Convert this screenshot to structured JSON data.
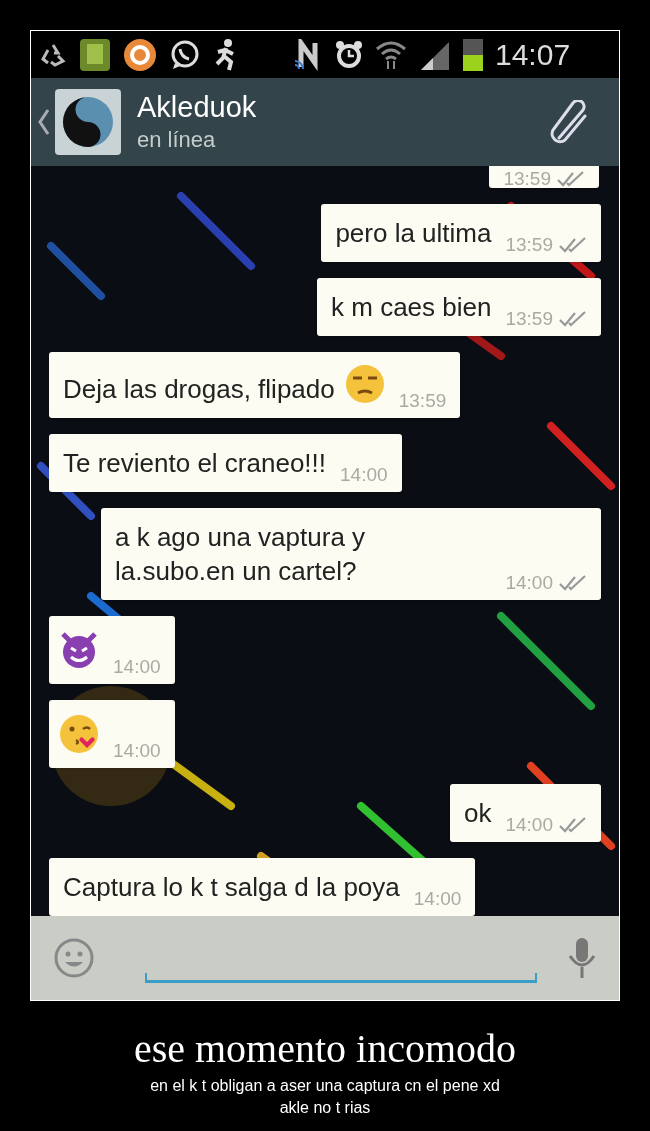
{
  "status_bar": {
    "time": "14:07"
  },
  "chat_header": {
    "contact_name": "Akleduok",
    "status": "en línea"
  },
  "messages": [
    {
      "kind": "sent",
      "time": "13:59"
    },
    {
      "kind": "sent",
      "text": "pero la ultima",
      "time": "13:59"
    },
    {
      "kind": "sent",
      "text": "k m caes bien",
      "time": "13:59"
    },
    {
      "kind": "received",
      "text": "Deja las drogas, flipado",
      "emoji": {
        "kind": "unamused"
      },
      "time": "13:59"
    },
    {
      "kind": "received",
      "text": "Te reviento el craneo!!!",
      "time": "14:00"
    },
    {
      "kind": "sent",
      "text": "a k ago una vaptura y la.subo.en un cartel?",
      "time": "14:00"
    },
    {
      "kind": "received",
      "emoji": {
        "kind": "devil"
      },
      "time": "14:00"
    },
    {
      "kind": "received",
      "emoji": {
        "kind": "kiss"
      },
      "time": "14:00"
    },
    {
      "kind": "sent",
      "text": "ok",
      "time": "14:00"
    },
    {
      "kind": "received",
      "text": "Captura lo k t salga d la poya",
      "time": "14:00"
    }
  ],
  "caption": {
    "title": "ese momento incomodo",
    "subtitle_lines": [
      "en el k t obligan a aser una captura cn el pene xd",
      "akle no t rias"
    ]
  }
}
